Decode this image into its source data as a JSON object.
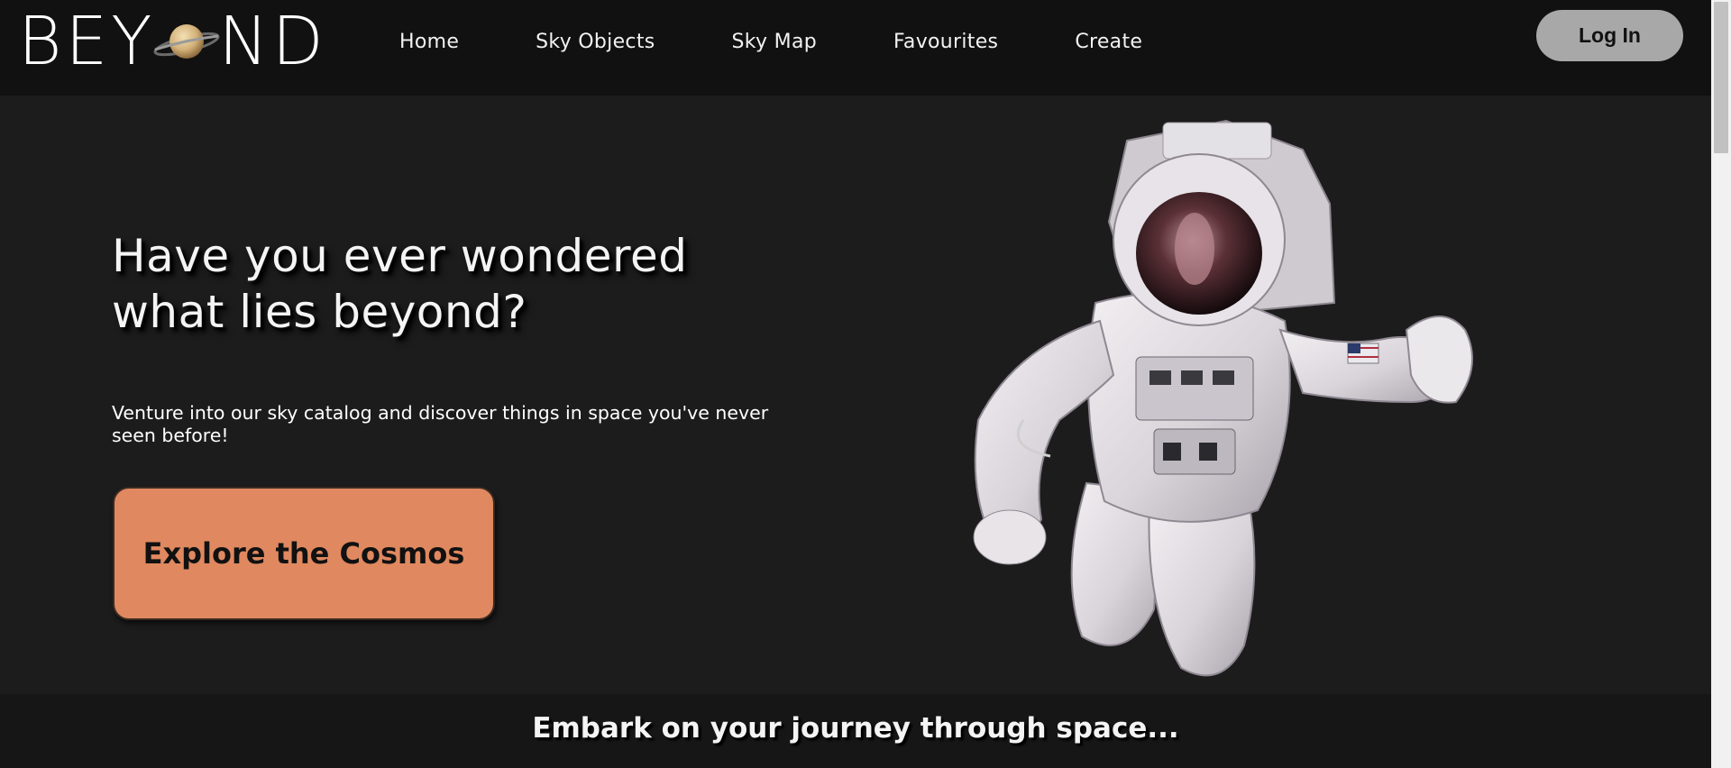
{
  "logo": {
    "text_before": "BEY",
    "text_after": "ND",
    "planet_icon": "saturn-icon"
  },
  "nav": {
    "items": [
      {
        "label": "Home"
      },
      {
        "label": "Sky Objects"
      },
      {
        "label": "Sky Map"
      },
      {
        "label": "Favourites"
      },
      {
        "label": "Create"
      }
    ],
    "login_label": "Log In"
  },
  "hero": {
    "title": "Have you ever wondered what lies beyond?",
    "subtitle": "Venture into our sky catalog and discover things in space you've never seen before!",
    "cta_label": "Explore the Cosmos",
    "image": "astronaut-image"
  },
  "journey": {
    "title": "Embark on your journey through space..."
  },
  "colors": {
    "navbar_bg": "#111111",
    "page_bg": "#1c1c1c",
    "cta_bg": "#e0885f",
    "login_bg": "#a8a8a8"
  }
}
